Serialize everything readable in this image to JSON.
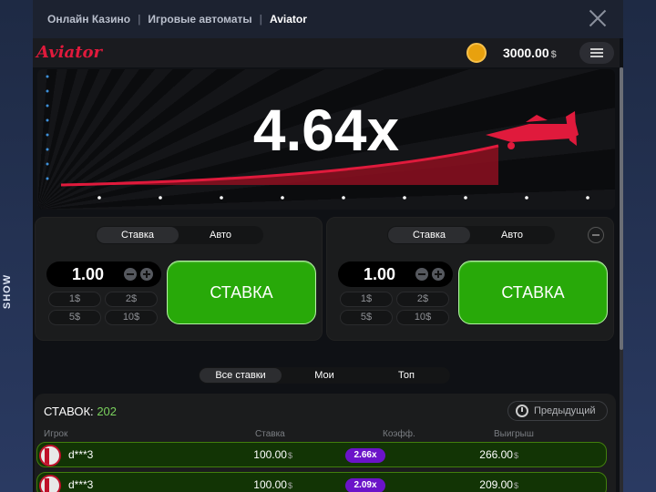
{
  "side_tab": {
    "label": "SHOW"
  },
  "breadcrumbs": [
    "Онлайн Казино",
    "Игровые автоматы",
    "Aviator"
  ],
  "game": {
    "logo": "Aviator",
    "balance": "3000.00",
    "currency": "$",
    "multiplier": "4.64x"
  },
  "bet_panels": [
    {
      "mode_tabs": [
        "Ставка",
        "Авто"
      ],
      "amount": "1.00",
      "quick": [
        "1",
        "2",
        "5",
        "10"
      ],
      "bet_label": "СТАВКА"
    },
    {
      "mode_tabs": [
        "Ставка",
        "Авто"
      ],
      "amount": "1.00",
      "quick": [
        "1",
        "2",
        "5",
        "10"
      ],
      "bet_label": "СТАВКА"
    }
  ],
  "bets_tabs": [
    "Все ставки",
    "Мои",
    "Топ"
  ],
  "bets": {
    "count_label": "СТАВОК:",
    "count": "202",
    "previous_label": "Предыдущий",
    "columns": [
      "Игрок",
      "Ставка",
      "Коэфф.",
      "Выигрыш"
    ],
    "rows": [
      {
        "player": "d***3",
        "bet": "100.00",
        "coef": "2.66x",
        "win": "266.00"
      },
      {
        "player": "d***3",
        "bet": "100.00",
        "coef": "2.09x",
        "win": "209.00"
      }
    ]
  },
  "colors": {
    "accent_red": "#e01a3c",
    "bet_green": "#28a909",
    "coef_purple": "#6b13c9"
  },
  "icons": [
    "close-icon",
    "coin-icon",
    "menu-icon",
    "plane-icon",
    "history-icon",
    "minus-icon",
    "plus-icon"
  ]
}
